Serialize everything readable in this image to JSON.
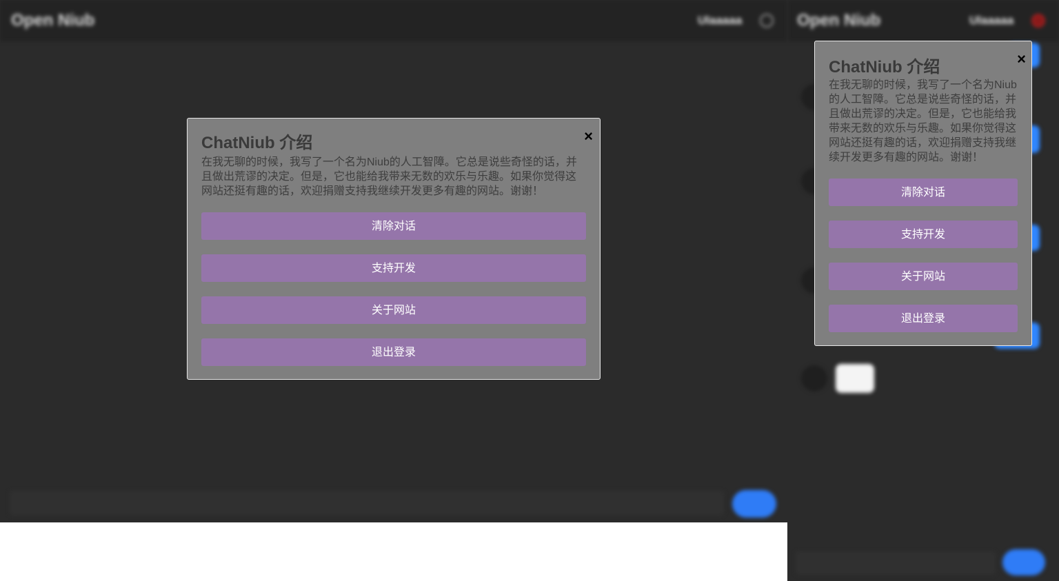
{
  "app": {
    "brand": "Open Niub",
    "username": "Ulaaaaa",
    "input_placeholder": "",
    "send_label": ""
  },
  "modal": {
    "title": "ChatNiub 介绍",
    "text": "在我无聊的时候，我写了一个名为Niub的人工智障。它总是说些奇怪的话，并且做出荒谬的决定。但是，它也能给我带来无数的欢乐与乐趣。如果你觉得这网站还挺有趣的话，欢迎捐赠支持我继续开发更多有趣的网站。谢谢！",
    "close_label": "×",
    "buttons": [
      "清除对话",
      "支持开发",
      "关于网站",
      "退出登录"
    ]
  },
  "colors": {
    "modal_bg": "#7f7f7f",
    "button_bg": "#9575aa",
    "accent_blue": "#2f7cf6",
    "app_bg": "#2b2b2b"
  },
  "icons": {
    "user": "user-circle-icon",
    "close": "close-icon"
  }
}
